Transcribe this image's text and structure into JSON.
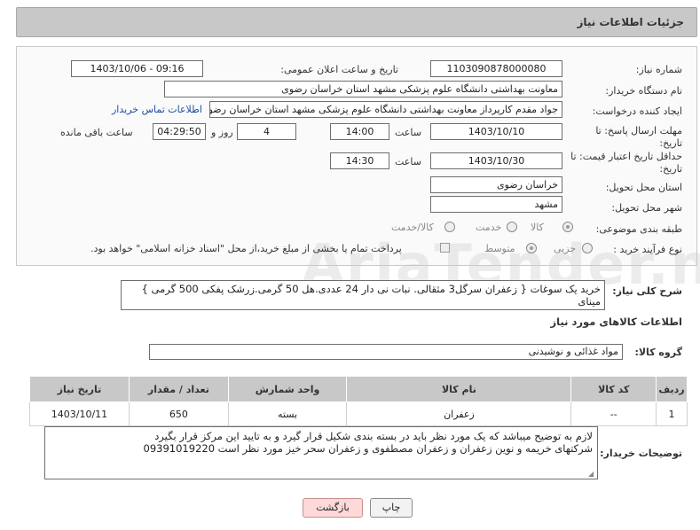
{
  "header": {
    "title": "جزئیات اطلاعات نیاز"
  },
  "form": {
    "need_number_label": "شماره نیاز:",
    "need_number": "1103090878000080",
    "announce_label": "تاریخ و ساعت اعلان عمومی:",
    "announce_value": "1403/10/06 - 09:16",
    "buyer_org_label": "نام دستگاه خریدار:",
    "buyer_org": "معاونت بهداشتی دانشگاه علوم پزشکی مشهد استان خراسان رضوی",
    "creator_label": "ایجاد کننده درخواست:",
    "creator": "جواد مقدم کارپرداز معاونت بهداشتی دانشگاه علوم پزشکی مشهد استان خراسان رضوی",
    "contact_link": "اطلاعات تماس خریدار",
    "deadline_label_1": "مهلت ارسال پاسخ: تا",
    "deadline_label_2": "تاریخ:",
    "deadline_date": "1403/10/10",
    "time_label": "ساعت",
    "deadline_time": "14:00",
    "days_value": "4",
    "days_label": "روز و",
    "remaining_time": "04:29:50",
    "remaining_label": "ساعت باقی مانده",
    "validity_label_1": "حداقل تاریخ اعتبار قیمت: تا",
    "validity_label_2": "تاریخ:",
    "validity_date": "1403/10/30",
    "validity_time": "14:30",
    "province_label": "استان محل تحویل:",
    "province": "خراسان رضوی",
    "city_label": "شهر محل تحویل:",
    "city": "مشهد",
    "category_label": "طبقه بندی موضوعی:",
    "category_options": [
      "کالا",
      "خدمت",
      "کالا/خدمت"
    ],
    "purchase_type_label": "نوع فرآیند خرید :",
    "purchase_options": [
      "جزیی",
      "متوسط"
    ],
    "payment_note": "پرداخت تمام یا بخشی از مبلغ خرید،از محل \"اسناد خزانه اسلامی\" خواهد بود."
  },
  "description": {
    "label": "شرح کلی نیاز:",
    "text": "خرید یک سوغات { زعفران سرگل3 مثقالی. نبات نی دار 24 عددی.هل  50 گرمی.زرشک پفکی 500 گرمی } مینای"
  },
  "goods": {
    "section_title": "اطلاعات کالاهای مورد نیاز",
    "group_label": "گروه کالا:",
    "group_value": "مواد غذائی و نوشیدنی",
    "columns": [
      "ردیف",
      "کد کالا",
      "نام کالا",
      "واحد شمارش",
      "تعداد / مقدار",
      "تاریخ نیاز"
    ],
    "rows": [
      {
        "row": "1",
        "code": "--",
        "name": "زعفران",
        "unit": "بسته",
        "qty": "650",
        "date": "1403/10/11"
      }
    ]
  },
  "buyer_notes": {
    "label": "توضیحات خریدار:",
    "line1": "لازم به توضیح میباشد که یک مورد نظر باید در بسته بندی شکیل قرار گیرد و به تایید این مرکز قرار بگیرد",
    "line2": "شرکتهای خریمه و نوین زعفران و زعفران مصطفوی و زعفران سحر خیز مورد نظر است 09391019220"
  },
  "buttons": {
    "print": "چاپ",
    "back": "بازگشت"
  },
  "watermark": {
    "text": "AriaTender.neT"
  },
  "colors": {
    "header_bg": "#c8c8c8",
    "link": "#1a4fa0",
    "back_button": "#ffd9d9"
  }
}
